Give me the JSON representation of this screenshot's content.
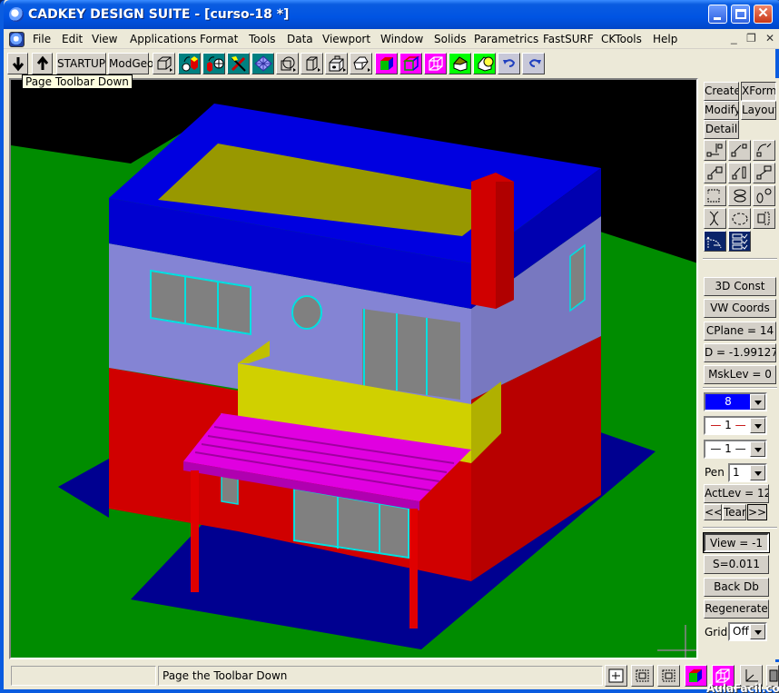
{
  "window": {
    "title": "CADKEY DESIGN SUITE - [curso-18 *]",
    "controls": {
      "minimize": "minimize",
      "maximize": "maximize",
      "close": "close"
    }
  },
  "menubar": {
    "items": [
      "File",
      "Edit",
      "View",
      "Applications",
      "Format",
      "Tools",
      "Data",
      "Viewport",
      "Window",
      "Solids",
      "Parametrics",
      "FastSURF",
      "CKTools",
      "Help"
    ],
    "mdi_controls": [
      "_",
      "❐",
      "✕"
    ]
  },
  "toolbar": {
    "page_down_icon": "arrow-down-icon",
    "page_up_icon": "arrow-up-icon",
    "startup_label": "STARTUP",
    "modgeo_label": "ModGeo",
    "tools": [
      {
        "name": "wireframe-box-icon",
        "bg": "gray"
      },
      {
        "name": "solid-rotate-icon",
        "bg": "teal"
      },
      {
        "name": "solid-rotate-alt-icon",
        "bg": "teal"
      },
      {
        "name": "hammer-tool-icon",
        "bg": "teal"
      },
      {
        "name": "mesh-surface-icon",
        "bg": "teal"
      },
      {
        "name": "circle-box-icon",
        "bg": "gray"
      },
      {
        "name": "cylinder-box-icon",
        "bg": "gray"
      },
      {
        "name": "solid-hole-icon",
        "bg": "gray"
      },
      {
        "name": "cube-outline-icon",
        "bg": "gray"
      },
      {
        "name": "shaded-cube-icon",
        "bg": "magenta"
      },
      {
        "name": "wire-color-cube-icon",
        "bg": "magenta"
      },
      {
        "name": "wire-cube-icon",
        "bg": "magenta"
      },
      {
        "name": "house-shaded-icon",
        "bg": "green"
      },
      {
        "name": "house-light-icon",
        "bg": "green"
      },
      {
        "name": "undo-icon",
        "bg": "grayblue"
      },
      {
        "name": "redo-icon",
        "bg": "grayblue"
      }
    ]
  },
  "tooltip": {
    "text": "Page Toolbar Down"
  },
  "right_panel": {
    "mode_buttons": [
      "Create",
      "XForm",
      "Modify",
      "Layout",
      "Detail"
    ],
    "active_mode": "XForm",
    "xform_icons": [
      "translate-copy-icon",
      "translate-join-icon",
      "rotate-copy-icon",
      "scale-icon",
      "move-icon",
      "drag-icon",
      "array-icon",
      "mirror-icon",
      "extrude-icon",
      "intersect-icon",
      "circular-array-icon",
      "offset-icon",
      "transform-path-icon",
      "checklist-icon"
    ],
    "buttons": [
      "3D Const",
      "VW Coords",
      "CPlane = 14",
      "D = -1.99127",
      "MskLev =  0"
    ],
    "color_value": "8",
    "color_swatch": "#0000ff",
    "line_type_value": "1",
    "line_width_value": "1",
    "pen_label": "Pen",
    "pen_value": "1",
    "actlev_label": "ActLev = 12",
    "prev_label": "<<",
    "tear_label": "Tear",
    "next_label": ">>",
    "view_label": "View = -1",
    "scale_label": "S=0.011",
    "backdb_label": "Back Db",
    "regenerate_label": "Regenerate",
    "grid_label": "Grid",
    "grid_value": "Off"
  },
  "statusbar": {
    "left_text": "",
    "message": "Page the Toolbar Down",
    "buttons": [
      "zoom-extents-icon",
      "zoom-window-icon",
      "zoom-box-icon",
      "shaded-view-icon",
      "wireframe-view-icon",
      "axis-icon",
      "face-icon"
    ]
  },
  "watermark": "AulaFacil.com",
  "scene": {
    "background": "#000000",
    "ground": "#008c00",
    "slab": "#000090",
    "wall_top": "#0000d0",
    "wall_upper": "#8080d0",
    "wall_lower": "#d00000",
    "roof": "#989800",
    "balcony": "#d0d000",
    "pergola": "#e000e0",
    "glass": "#808080",
    "frame": "#00e0e0"
  }
}
